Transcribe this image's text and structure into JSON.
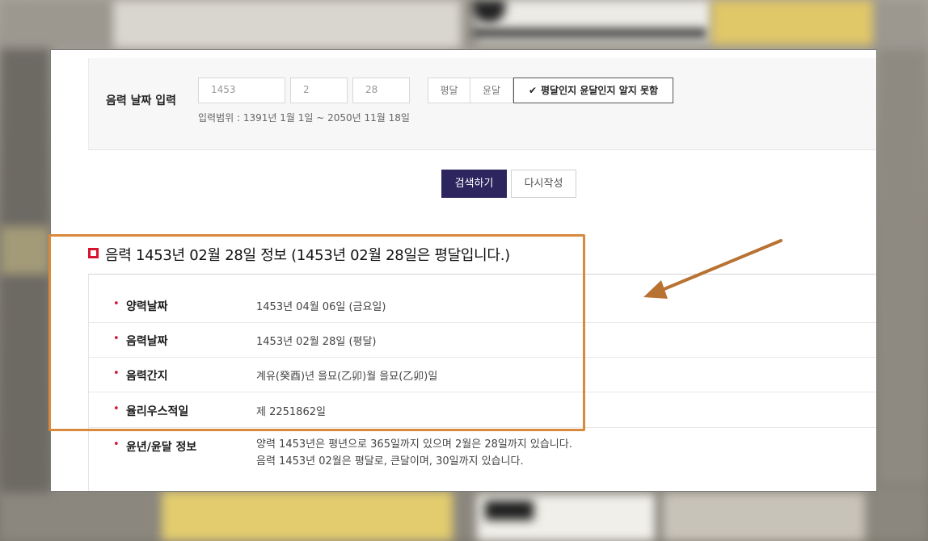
{
  "form": {
    "label": "음력 날짜 입력",
    "year": "1453",
    "month": "2",
    "day": "28",
    "options": [
      "평달",
      "윤달",
      "평달인지 윤달인지 알지 못함"
    ],
    "selected_option": "평달인지 윤달인지 알지 못함",
    "range_note": "입력범위 : 1391년 1월 1일 ~ 2050년 11월 18일"
  },
  "actions": {
    "search": "검색하기",
    "reset": "다시작성"
  },
  "result": {
    "heading": "음력 1453년 02월 28일 정보 (1453년 02월 28일은 평달입니다.)",
    "rows": [
      {
        "key": "양력날짜",
        "value": "1453년 04월 06일 (금요일)"
      },
      {
        "key": "음력날짜",
        "value": "1453년 02월 28일 (평달)"
      },
      {
        "key": "음력간지",
        "value": "계유(癸酉)년 을묘(乙卯)월 을묘(乙卯)일"
      },
      {
        "key": "율리우스적일",
        "value": "제 2251862일"
      },
      {
        "key": "윤년/윤달 정보",
        "value": "양력 1453년은 평년으로 365일까지 있으며 2월은 28일까지 있습니다.",
        "value2": "음력 1453년 02월은 평달로, 큰달이며, 30일까지 있습니다."
      }
    ]
  },
  "colors": {
    "primary_button": "#2c255e",
    "accent_red": "#d8132f",
    "annotation_orange": "#d9893c",
    "arrow_brown": "#b87333"
  },
  "icons": {
    "check": "check-icon",
    "bullet": "bullet-icon",
    "heading_marker": "square-marker-icon",
    "annotation_arrow": "arrow-icon"
  }
}
